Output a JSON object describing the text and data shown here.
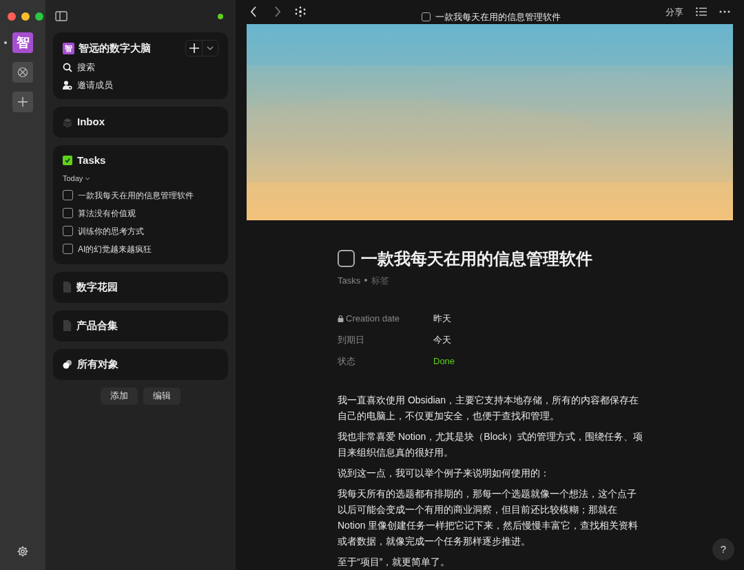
{
  "rail": {
    "items": [
      {
        "kind": "avatar",
        "label": "智",
        "selected": true
      },
      {
        "kind": "space",
        "selected": false
      },
      {
        "kind": "add",
        "selected": false
      }
    ]
  },
  "sidebar": {
    "workspace": {
      "initial": "智",
      "name": "智远的数字大脑"
    },
    "actions": [
      {
        "kind": "search",
        "label": "搜索"
      },
      {
        "kind": "invite",
        "label": "邀请成员"
      }
    ],
    "widgets": [
      {
        "kind": "inbox",
        "title": "Inbox"
      },
      {
        "kind": "tasks",
        "title": "Tasks",
        "filter": "Today",
        "items": [
          {
            "label": "一款我每天在用的信息管理软件",
            "checked": false
          },
          {
            "label": "算法没有价值观",
            "checked": false
          },
          {
            "label": "训练你的思考方式",
            "checked": false
          },
          {
            "label": "AI的幻觉越来越疯狂",
            "checked": false
          }
        ]
      },
      {
        "kind": "page",
        "title": "数字花园"
      },
      {
        "kind": "page",
        "title": "产品合集"
      },
      {
        "kind": "objects",
        "title": "所有对象"
      }
    ],
    "buttons": [
      "添加",
      "编辑"
    ]
  },
  "topbar": {
    "title": "一款我每天在用的信息管理软件",
    "checked": false,
    "share": "分享"
  },
  "document": {
    "title": "一款我每天在用的信息管理软件",
    "checked": false,
    "type": "Tasks",
    "tag": "标签",
    "properties": [
      {
        "label": "Creation date",
        "locked": true,
        "value": "昨天"
      },
      {
        "label": "到期日",
        "locked": false,
        "value": "今天"
      },
      {
        "label": "状态",
        "locked": false,
        "value": "Done",
        "color": "#5fd01a"
      }
    ],
    "paragraphs": [
      "我一直喜欢使用 Obsidian，主要它支持本地存储，所有的内容都保存在自己的电脑上，不仅更加安全，也便于查找和管理。",
      "我也非常喜爱 Notion，尤其是块（Block）式的管理方式，围绕任务、项目来组织信息真的很好用。",
      "说到这一点，我可以举个例子来说明如何使用的：",
      "我每天所有的选题都有排期的，那每一个选题就像一个想法，这个点子以后可能会变成一个有用的商业洞察，但目前还比较模糊；那就在 Notion 里像创建任务一样把它记下来，然后慢慢丰富它，查找相关资料或者数据，就像完成一个任务那样逐步推进。",
      "至于“项目”，就更简单了。"
    ]
  },
  "help": "?"
}
